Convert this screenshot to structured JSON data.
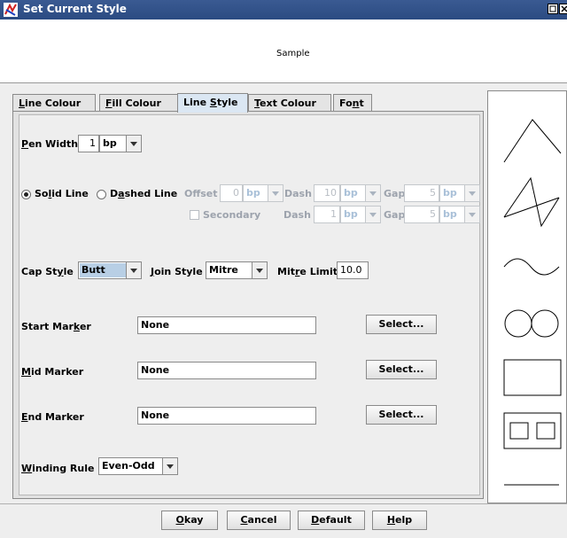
{
  "window": {
    "title": "Set Current Style"
  },
  "sample": {
    "text": "Sample"
  },
  "tabs": [
    {
      "pre": "",
      "key": "L",
      "post": "ine Colour",
      "active": false
    },
    {
      "pre": "",
      "key": "F",
      "post": "ill Colour",
      "active": false
    },
    {
      "pre": "Line ",
      "key": "S",
      "post": "tyle",
      "active": true
    },
    {
      "pre": "",
      "key": "T",
      "post": "ext Colour",
      "active": false
    },
    {
      "pre": "Fo",
      "key": "n",
      "post": "t",
      "active": false
    }
  ],
  "line_style": {
    "pen_width": {
      "pre": "",
      "key": "P",
      "post": "en Width",
      "value": "1",
      "unit": "bp"
    },
    "solid": {
      "pre": "So",
      "key": "l",
      "post": "id Line",
      "selected": true
    },
    "dashed": {
      "pre": "D",
      "key": "a",
      "post": "shed Line",
      "selected": false
    },
    "offset": {
      "label": "Offset",
      "value": "0",
      "unit": "bp"
    },
    "dash1": {
      "label": "Dash",
      "value": "10",
      "unit": "bp"
    },
    "gap1": {
      "label": "Gap",
      "value": "5",
      "unit": "bp"
    },
    "secondary": {
      "label": "Secondary",
      "checked": false
    },
    "dash2": {
      "label": "Dash",
      "value": "1",
      "unit": "bp"
    },
    "gap2": {
      "label": "Gap",
      "value": "5",
      "unit": "bp"
    },
    "cap_style": {
      "pre": "Cap St",
      "key": "y",
      "post": "le",
      "value": "Butt"
    },
    "join_style": {
      "pre": "",
      "key": "J",
      "post": "oin Style",
      "value": "Mitre"
    },
    "mitre_limit": {
      "pre": "Mit",
      "key": "r",
      "post": "e Limit",
      "value": "10.0"
    },
    "start_marker": {
      "pre": "Start Mar",
      "key": "k",
      "post": "er",
      "value": "None",
      "button": "Select..."
    },
    "mid_marker": {
      "pre": "",
      "key": "M",
      "post": "id Marker",
      "value": "None",
      "button": "Select..."
    },
    "end_marker": {
      "pre": "",
      "key": "E",
      "post": "nd Marker",
      "value": "None",
      "button": "Select..."
    },
    "winding_rule": {
      "pre": "",
      "key": "W",
      "post": "inding Rule",
      "value": "Even-Odd"
    }
  },
  "shapes_preview": [
    "angle-line-icon",
    "zigzag-icon",
    "sine-wave-icon",
    "two-circles-icon",
    "rectangle-icon",
    "two-squares-icon",
    "straight-line-icon"
  ],
  "buttons": {
    "okay": {
      "pre": "",
      "key": "O",
      "post": "kay"
    },
    "cancel": {
      "pre": "",
      "key": "C",
      "post": "ancel"
    },
    "default": {
      "pre": "",
      "key": "D",
      "post": "efault"
    },
    "help": {
      "pre": "",
      "key": "H",
      "post": "elp"
    }
  }
}
